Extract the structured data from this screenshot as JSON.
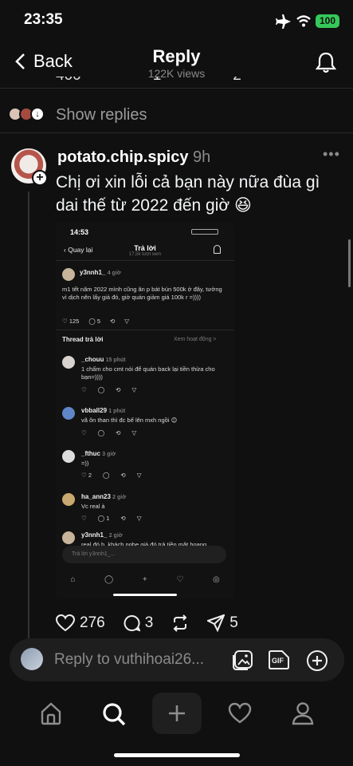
{
  "status_bar": {
    "time": "23:35",
    "battery": "100"
  },
  "header": {
    "back_label": "Back",
    "title": "Reply",
    "views": "122K views"
  },
  "top_partial": {
    "likes": "400",
    "reposts": "1",
    "shares": "2"
  },
  "show_replies": {
    "label": "Show replies"
  },
  "post": {
    "username": "potato.chip.spicy",
    "time_ago": "9h",
    "text": "Chị ơi xin lỗi cả bạn này nữa đùa gì dai thế từ 2022 đến giờ 😆",
    "likes": "276",
    "comments": "3",
    "shares": "5"
  },
  "embedded": {
    "time": "14:53",
    "back_label": "Quay lại",
    "title": "Trả lời",
    "views": "17,5k lượt xem",
    "original": {
      "username": "y3nnh1_",
      "time_ago": "4 giờ",
      "text": "m1 tết năm 2022 mình cũng ăn p bát bún 500k ở đây, tưởng vì dịch nên lấy giá đó, giờ quán giảm giá 100k r =))))",
      "likes": "125",
      "comments": "5"
    },
    "thread_label": "Thread trả lời",
    "activity_label": "Xem hoạt động >",
    "replies": [
      {
        "username": "_chouu",
        "time_ago": "15 phút",
        "text": "1 chấm cho cmt nói để quán back lại tiền thừa cho bạn=))))"
      },
      {
        "username": "vbball29",
        "time_ago": "1 phút",
        "text": "vã ôn than thì đc bế lên mxh ngồi 😊"
      },
      {
        "username": "_fthuc",
        "time_ago": "3 giờ",
        "text": "=))",
        "likes": "2"
      },
      {
        "username": "ha_ann23",
        "time_ago": "2 giờ",
        "text": "Vc real à",
        "comments": "1"
      },
      {
        "username": "y3nnh1_",
        "time_ago": "2 giờ",
        "text": "real đó b, khách nghe giá đó trả tiền mặt hoang"
      }
    ],
    "reply_placeholder": "Trả lời y3nnh1_..."
  },
  "reply_bar": {
    "placeholder": "Reply to vuthihoai26..."
  },
  "colors": {
    "background": "#101010",
    "text": "#f3f5f7",
    "muted": "#8a8a8a",
    "battery": "#35c759"
  }
}
